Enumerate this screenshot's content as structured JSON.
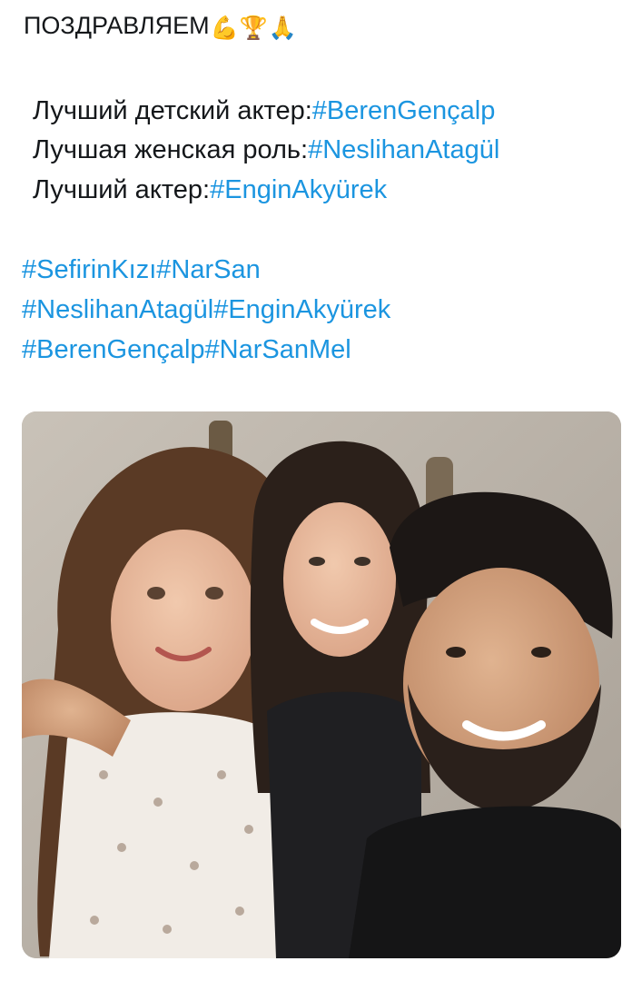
{
  "tweet": {
    "heading": "ПОЗДРАВЛЯЕМ",
    "heading_emojis": [
      "💪",
      "🏆",
      "🙏"
    ],
    "award_lines": [
      {
        "label": "Лучший детский актер:",
        "hashtag": "#BerenGençalp"
      },
      {
        "label": "Лучшая женская роль:",
        "hashtag": "#NeslihanAtagül"
      },
      {
        "label": "Лучший актер:",
        "hashtag": "#EnginAkyürek"
      }
    ],
    "hashtag_lines": [
      [
        "#SefirinKızı",
        "#NarSan"
      ],
      [
        "#NeslihanAtagül",
        "#EnginAkyürek"
      ],
      [
        "#BerenGençalp",
        "#NarSanMel"
      ]
    ]
  },
  "colors": {
    "text": "#14171a",
    "hashtag": "#1b95e0",
    "background": "#ffffff"
  },
  "icons": {
    "heading_emojis": [
      "flexed-biceps-icon",
      "trophy-icon",
      "folded-hands-icon"
    ]
  }
}
